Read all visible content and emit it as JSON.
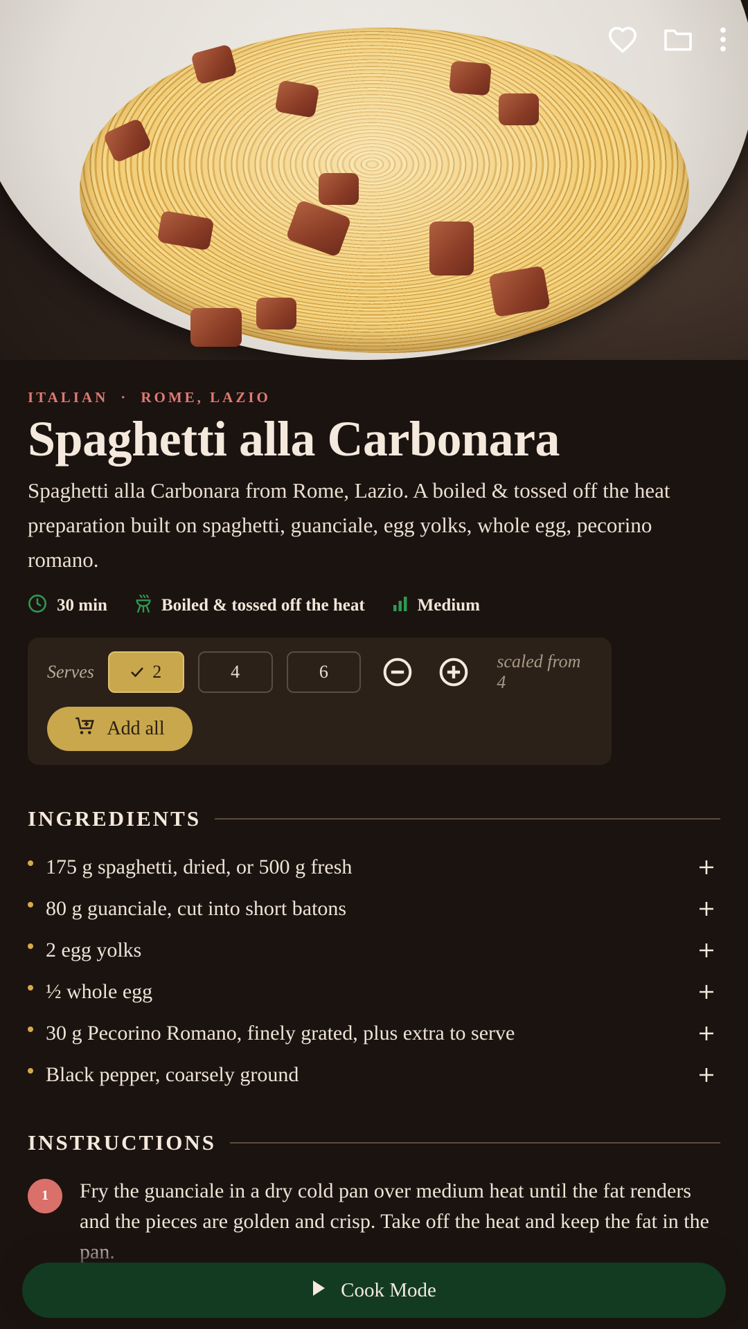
{
  "hero": {
    "icons": [
      "heart-outline-icon",
      "folder-outline-icon",
      "more-vertical-icon"
    ]
  },
  "recipe": {
    "cuisine": "ITALIAN",
    "separator": "·",
    "region": "ROME, LAZIO",
    "title": "Spaghetti alla Carbonara",
    "description": "Spaghetti alla Carbonara from Rome, Lazio. A boiled & tossed off the heat preparation built on spaghetti, guanciale, egg yolks, whole egg, pecorino romano.",
    "meta": {
      "time": "30 min",
      "method": "Boiled & tossed off the heat",
      "difficulty": "Medium"
    }
  },
  "serves": {
    "label": "Serves",
    "options": [
      "2",
      "4",
      "6"
    ],
    "selected": "2",
    "scaled_note": "scaled from 4",
    "add_all_label": "Add all"
  },
  "ingredients": {
    "heading": "INGREDIENTS",
    "items": [
      "175 g spaghetti, dried, or 500 g fresh",
      "80 g guanciale, cut into short batons",
      "2 egg yolks",
      "½ whole egg",
      "30 g Pecorino Romano, finely grated, plus extra to serve",
      "Black pepper, coarsely ground"
    ]
  },
  "instructions": {
    "heading": "INSTRUCTIONS",
    "steps": [
      {
        "number": "1",
        "text": "Fry the guanciale in a dry cold pan over medium heat until the fat renders and the pieces are golden and crisp. Take off the heat and keep the fat in the pan."
      }
    ]
  },
  "cook_mode": {
    "label": "Cook Mode"
  },
  "colors": {
    "background": "#1b1310",
    "accent_gold": "#c9a74c",
    "accent_coral": "#e07a74",
    "accent_green": "#2e9a52",
    "cook_button": "#123b22"
  }
}
